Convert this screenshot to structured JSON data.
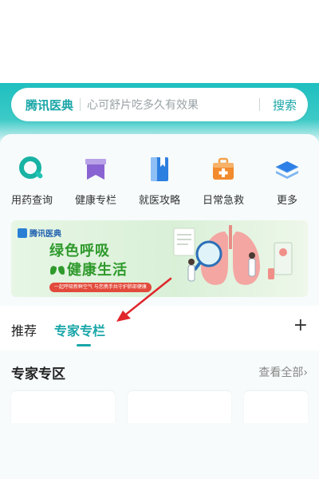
{
  "search": {
    "brand": "腾讯医典",
    "placeholder": "心可舒片吃多久有效果",
    "button": "搜索"
  },
  "quick_actions": [
    {
      "label": "用药查询",
      "icon": "pill-search-icon"
    },
    {
      "label": "健康专栏",
      "icon": "bookmark-column-icon"
    },
    {
      "label": "就医攻略",
      "icon": "guide-book-icon"
    },
    {
      "label": "日常急救",
      "icon": "first-aid-kit-icon"
    },
    {
      "label": "更多",
      "icon": "layers-icon"
    }
  ],
  "banner": {
    "brand": "腾讯医典",
    "line1": "绿色呼吸",
    "line2": "健康生活",
    "tagline": "一起呼吸新鲜空气 与您携手共守护肺部健康"
  },
  "tabs": [
    {
      "label": "推荐",
      "active": false
    },
    {
      "label": "专家专栏",
      "active": true
    }
  ],
  "section": {
    "title": "专家专区",
    "view_all": "查看全部",
    "chevron": "›"
  },
  "colors": {
    "accent": "#1aa6a8",
    "header": "#1fbfc0",
    "banner_green": "#2f9a2c",
    "annotation_red": "#e0262b"
  }
}
